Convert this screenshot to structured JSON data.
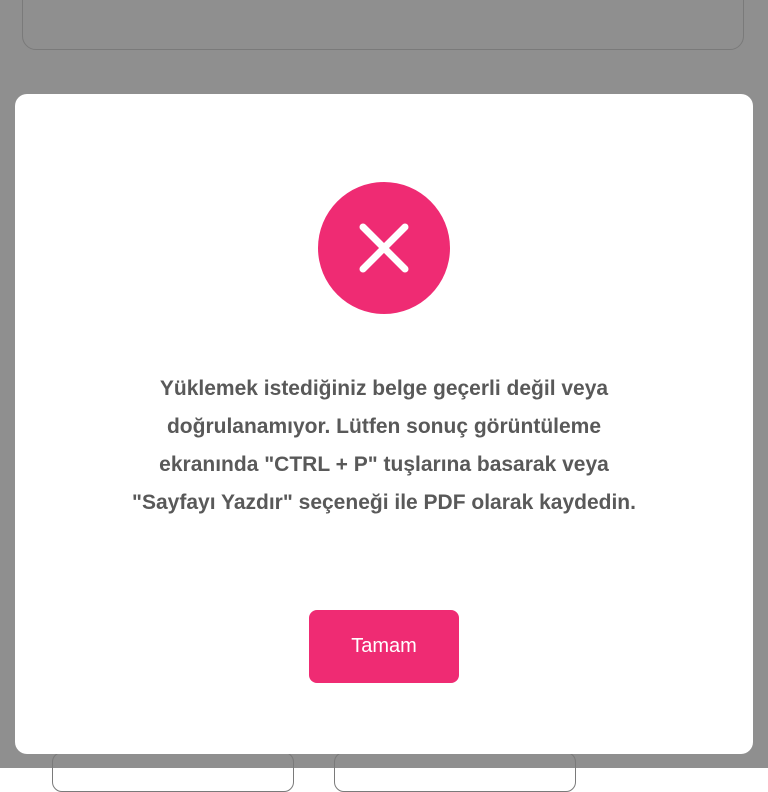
{
  "dialog": {
    "icon": "close-icon",
    "message_lines": [
      "Yüklemek istediğiniz belge geçerli değil veya",
      "doğrulanamıyor. Lütfen sonuç görüntüleme",
      "ekranında \"CTRL + P\" tuşlarına basarak veya",
      "\"Sayfayı Yazdır\" seçeneği ile PDF olarak kaydedin."
    ],
    "confirm_label": "Tamam"
  },
  "colors": {
    "accent": "#ef2b73",
    "backdrop": "#8f8f8f",
    "text": "#595959"
  }
}
